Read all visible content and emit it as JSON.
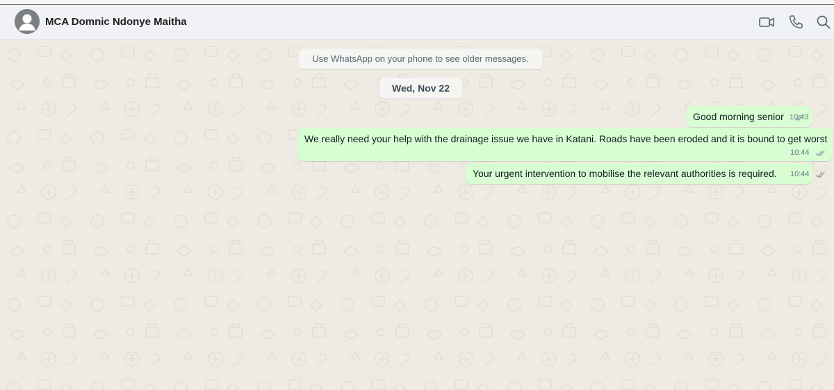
{
  "header": {
    "contact_name": "MCA Domnic Ndonye Maitha",
    "icons": [
      "avatar-placeholder",
      "video-call-icon",
      "phone-icon",
      "search-icon"
    ]
  },
  "chat": {
    "system_notice": "Use WhatsApp on your phone to see older messages.",
    "date_label": "Wed, Nov 22",
    "messages": [
      {
        "text": "Good morning senior",
        "time": "10:43",
        "status": "read"
      },
      {
        "text": "We really need your help with the drainage issue we have in Katani. Roads have been eroded and it is bound to get worst",
        "time": "10:44",
        "status": "read"
      },
      {
        "text": "Your urgent intervention to mobilise the relevant authorities is required.",
        "time": "10:44",
        "status": "read"
      }
    ]
  },
  "colors": {
    "header_bg": "#f0f2f5",
    "chat_bg": "#efeae2",
    "outgoing_bubble": "#d9fdd3",
    "meta_text": "#667781"
  }
}
